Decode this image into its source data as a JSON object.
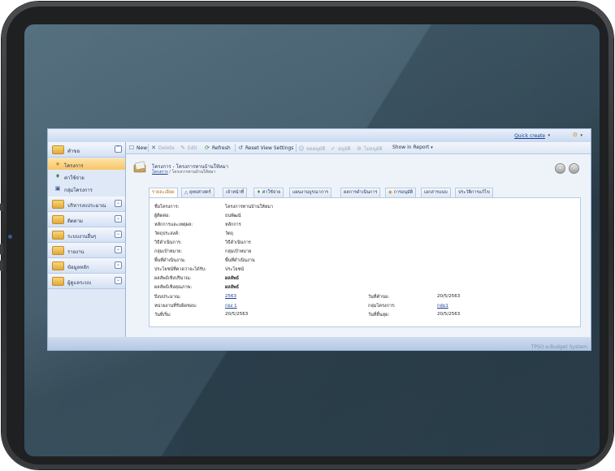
{
  "topbar": {
    "quick_create": "Quick create",
    "caret": "▾"
  },
  "sidebar": {
    "groups": [
      {
        "label": "คำขอ"
      },
      {
        "label": "บริหารงบประมาณ"
      },
      {
        "label": "ติดตาม"
      },
      {
        "label": "ระบบงานอื่นๆ"
      },
      {
        "label": "รายงาน"
      },
      {
        "label": "ข้อมูลหลัก"
      },
      {
        "label": "ผู้ดูแลระบบ"
      }
    ],
    "items": [
      {
        "label": "โครงการ",
        "selected": true
      },
      {
        "label": "ค่าใช้จ่าย"
      },
      {
        "label": "กลุ่มโครงการ"
      }
    ]
  },
  "toolbar": {
    "new": "New",
    "delete": "Delete",
    "edit": "Edit",
    "refresh": "Refresh",
    "reset": "Reset View Settings",
    "request": "ขออนุมัติ",
    "approve": "อนุมัติ",
    "reject": "ไม่อนุมัติ",
    "show_report": "Show in Report"
  },
  "header": {
    "title": "โครงการ - โครงการทานบ้านให้หมา",
    "crumb_link": "โครงการ",
    "crumb_rest": " / โครงการทานบ้านให้หมา"
  },
  "tabs": [
    "รายละเอียด",
    "ยุทธศาสตร์",
    "เจ้าหน้าที่",
    "ค่าใช้จ่าย",
    "แผนงานบูรณาการ",
    "ผลการดำเนินการ",
    "การอนุมัติ",
    "เอกสารแนบ",
    "ประวัติการแก้ไข"
  ],
  "details": [
    {
      "label": "ชื่อโครงการ:",
      "value": "โครงการทานบ้านให้หมา"
    },
    {
      "label": "ผู้ติดต่อ:",
      "value": "ธนพัฒน์"
    },
    {
      "label": "หลักการและเหตุผล:",
      "value": "หลักการ"
    },
    {
      "label": "วัตถุประสงค์:",
      "value": "วัตถุ"
    },
    {
      "label": "วิธีดำเนินการ:",
      "value": "วิธีดำเนินการ"
    },
    {
      "label": "กลุ่มเป้าหมาย:",
      "value": "กลุ่มเป้าหมาย"
    },
    {
      "label": "พื้นที่ดำเนินงาน:",
      "value": "พื้นที่ดำเนินงาน"
    },
    {
      "label": "ประโยชน์ที่คาดว่าจะได้รับ:",
      "value": "ประโยชน์"
    },
    {
      "label": "ผลลัพธ์เชิงปริมาณ:",
      "value": "ผลลัพธ์"
    },
    {
      "label": "ผลลัพธ์เชิงคุณภาพ:",
      "value": "ผลลัพธ์"
    }
  ],
  "pairs": [
    {
      "l1": "ปีงบประมาณ:",
      "v1": "2563",
      "l2": "วันที่คำขอ:",
      "v2": "20/5/2563"
    },
    {
      "l1": "หน่วยงานที่รับผิดชอบ:",
      "v1": "กอง 1",
      "l2": "กลุ่มโครงการ:",
      "v2": "กลุ่ม1"
    },
    {
      "l1": "วันที่เริ่ม:",
      "v1": "20/5/2563",
      "l2": "วันที่สิ้นสุด:",
      "v2": "20/5/2563"
    }
  ],
  "status": {
    "brand": "TPSO e-Budget System"
  }
}
